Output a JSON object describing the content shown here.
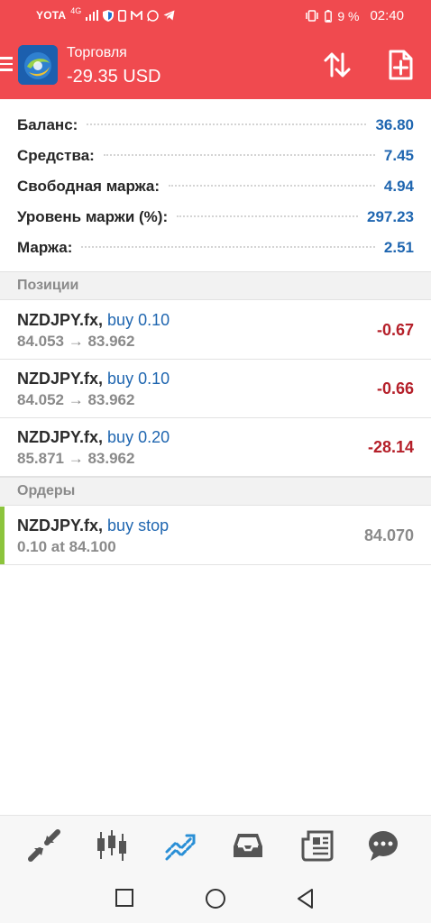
{
  "status_bar": {
    "carrier": "YOTA",
    "network": "4G",
    "battery": "9 %",
    "time": "02:40"
  },
  "header": {
    "title": "Торговля",
    "subtitle": "-29.35 USD",
    "colors": {
      "background": "#f04a4f",
      "text": "#ffffff"
    }
  },
  "summary": [
    {
      "label": "Баланс:",
      "value": "36.80"
    },
    {
      "label": "Средства:",
      "value": "7.45"
    },
    {
      "label": "Свободная маржа:",
      "value": "4.94"
    },
    {
      "label": "Уровень маржи (%):",
      "value": "297.23"
    },
    {
      "label": "Маржа:",
      "value": "2.51"
    }
  ],
  "positions_section": {
    "title": "Позиции"
  },
  "positions": [
    {
      "symbol": "NZDJPY.fx,",
      "side": "buy 0.10",
      "prices": "84.053 → 83.962",
      "profit": "-0.67"
    },
    {
      "symbol": "NZDJPY.fx,",
      "side": "buy 0.10",
      "prices": "84.052 → 83.962",
      "profit": "-0.66"
    },
    {
      "symbol": "NZDJPY.fx,",
      "side": "buy 0.20",
      "prices": "85.871 → 83.962",
      "profit": "-28.14"
    }
  ],
  "orders_section": {
    "title": "Ордеры"
  },
  "orders": [
    {
      "symbol": "NZDJPY.fx,",
      "side": "buy stop",
      "details": "0.10 at 84.100",
      "price": "84.070"
    }
  ],
  "tabs": [
    {
      "icon": "quotes-arrows-icon"
    },
    {
      "icon": "chart-candles-icon"
    },
    {
      "icon": "trade-icon",
      "active": true
    },
    {
      "icon": "history-inbox-icon"
    },
    {
      "icon": "news-icon"
    },
    {
      "icon": "chat-icon"
    }
  ],
  "colors": {
    "accent_blue": "#1f66b0",
    "loss_red": "#b5202a",
    "order_accent": "#8cc43c",
    "active_tab": "#2a8fd6"
  }
}
